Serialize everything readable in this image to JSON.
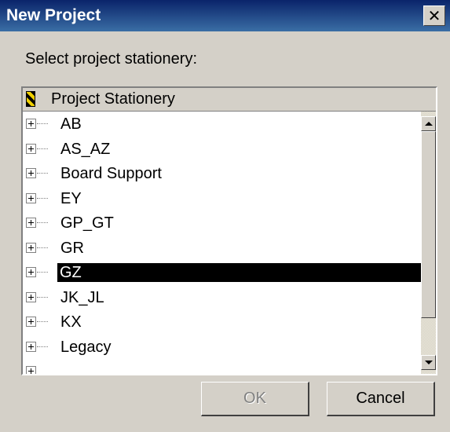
{
  "window": {
    "title": "New Project",
    "close_glyph": "✕"
  },
  "prompt": "Select project stationery:",
  "tree": {
    "header": "Project Stationery",
    "header_icon": "stationery-icon",
    "items": [
      {
        "label": "AB",
        "selected": false
      },
      {
        "label": "AS_AZ",
        "selected": false
      },
      {
        "label": "Board Support",
        "selected": false
      },
      {
        "label": "EY",
        "selected": false
      },
      {
        "label": "GP_GT",
        "selected": false
      },
      {
        "label": "GR",
        "selected": false
      },
      {
        "label": "GZ",
        "selected": true
      },
      {
        "label": "JK_JL",
        "selected": false
      },
      {
        "label": "KX",
        "selected": false
      },
      {
        "label": "Legacy",
        "selected": false
      }
    ]
  },
  "buttons": {
    "ok_label": "OK",
    "ok_enabled": false,
    "cancel_label": "Cancel"
  },
  "colors": {
    "title_bar": "#0a246a",
    "selection_bg": "#000000",
    "dialog_bg": "#d4d0c8"
  }
}
